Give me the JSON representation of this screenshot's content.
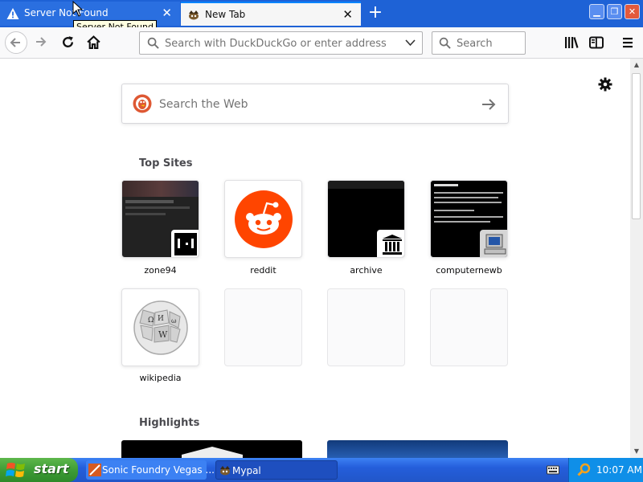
{
  "browser": {
    "tabs": [
      {
        "title": "Server Not Found",
        "icon": "warning-icon",
        "active": false
      },
      {
        "title": "New Tab",
        "icon": "mypal-icon",
        "active": true
      }
    ],
    "tooltip": "Server Not Found",
    "urlbar_placeholder": "Search with DuckDuckGo or enter address",
    "searchbar_placeholder": "Search"
  },
  "newtab": {
    "search_placeholder": "Search the Web",
    "top_sites_title": "Top Sites",
    "top_sites": [
      {
        "label": "zone94"
      },
      {
        "label": "reddit"
      },
      {
        "label": "archive"
      },
      {
        "label": "computernewb"
      },
      {
        "label": "wikipedia"
      }
    ],
    "highlights_title": "Highlights"
  },
  "taskbar": {
    "start_label": "start",
    "tasks": [
      {
        "label": "Sonic Foundry Vegas ..."
      },
      {
        "label": "Mypal"
      }
    ],
    "clock": "10:07 AM"
  },
  "colors": {
    "titlebar": "#1e62d6",
    "reddit": "#ff4500",
    "accent": "#0a84ff",
    "taskbar": "#245edb",
    "start": "#3c9a34"
  }
}
